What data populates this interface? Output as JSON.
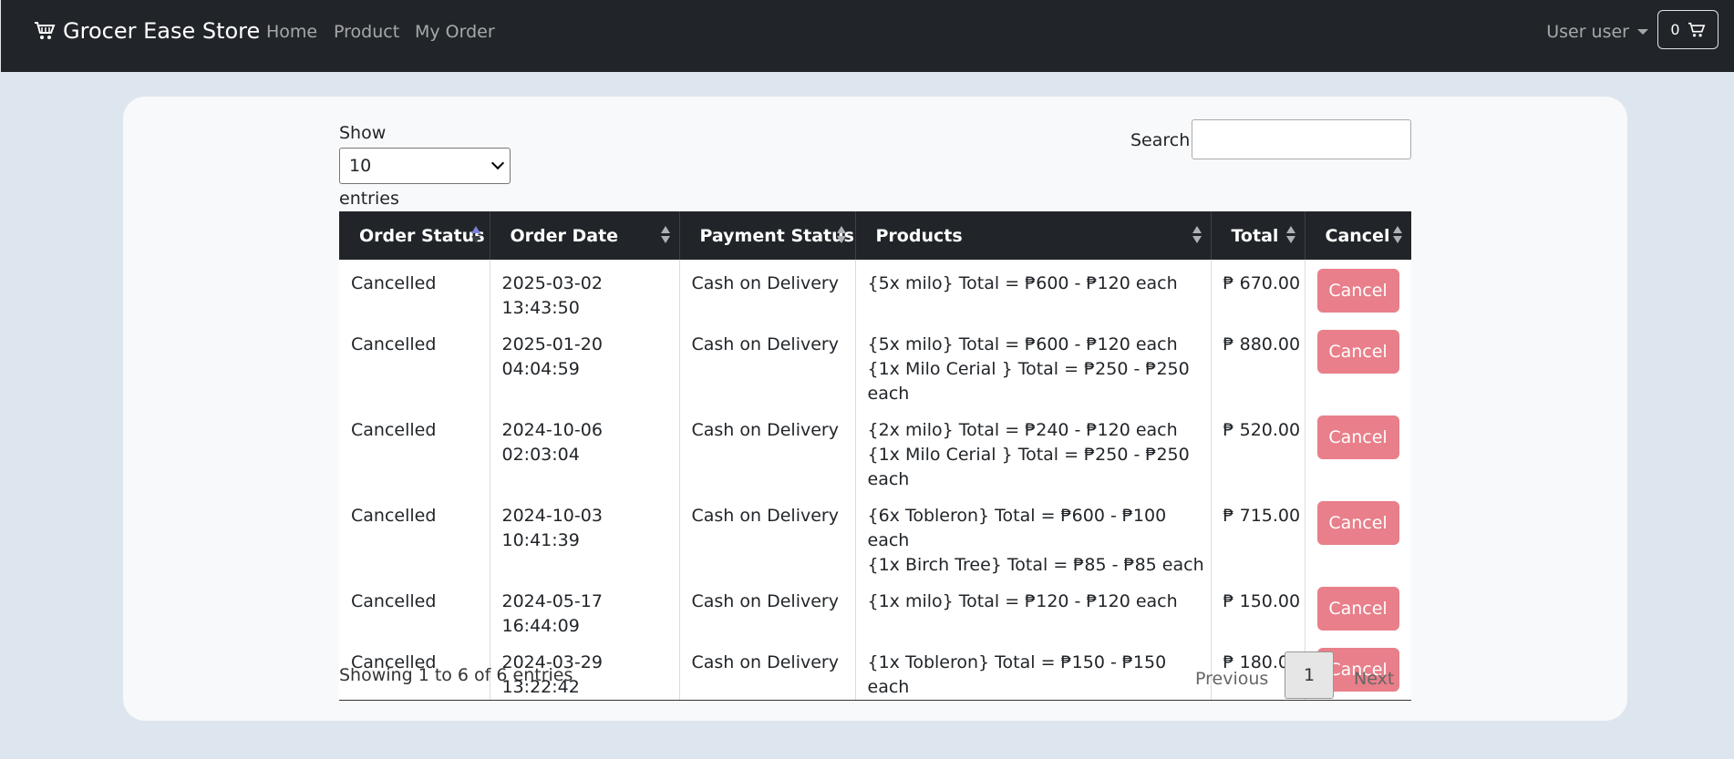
{
  "nav": {
    "brand": "Grocer Ease Store",
    "links": [
      "Home",
      "Product",
      "My Order"
    ],
    "user": "User user",
    "cart_count": "0"
  },
  "table_controls": {
    "show_label": "Show",
    "page_size": "10",
    "entries_label": "entries",
    "search_label": "Search:",
    "search_value": ""
  },
  "table": {
    "headers": [
      "Order Status",
      "Order Date",
      "Payment Status",
      "Products",
      "Total",
      "Cancel"
    ],
    "rows": [
      {
        "status": "Cancelled",
        "date": "2025-03-02 13:43:50",
        "payment": "Cash on Delivery",
        "products": [
          "{5x milo} Total = ₱600 - ₱120 each"
        ],
        "total": "₱ 670.00",
        "action": "Cancel"
      },
      {
        "status": "Cancelled",
        "date": "2025-01-20 04:04:59",
        "payment": "Cash on Delivery",
        "products": [
          "{5x milo} Total = ₱600 - ₱120 each",
          "{1x Milo Cerial } Total = ₱250 - ₱250 each"
        ],
        "total": "₱ 880.00",
        "action": "Cancel"
      },
      {
        "status": "Cancelled",
        "date": "2024-10-06 02:03:04",
        "payment": "Cash on Delivery",
        "products": [
          "{2x milo} Total = ₱240 - ₱120 each",
          "{1x Milo Cerial } Total = ₱250 - ₱250 each"
        ],
        "total": "₱ 520.00",
        "action": "Cancel"
      },
      {
        "status": "Cancelled",
        "date": "2024-10-03 10:41:39",
        "payment": "Cash on Delivery",
        "products": [
          "{6x Tobleron} Total = ₱600 - ₱100 each",
          "{1x Birch Tree} Total = ₱85 - ₱85 each"
        ],
        "total": "₱ 715.00",
        "action": "Cancel"
      },
      {
        "status": "Cancelled",
        "date": "2024-05-17 16:44:09",
        "payment": "Cash on Delivery",
        "products": [
          "{1x milo} Total = ₱120 - ₱120 each"
        ],
        "total": "₱ 150.00",
        "action": "Cancel"
      },
      {
        "status": "Cancelled",
        "date": "2024-03-29 13:22:42",
        "payment": "Cash on Delivery",
        "products": [
          "{1x Tobleron} Total = ₱150 - ₱150 each"
        ],
        "total": "₱ 180.00",
        "action": "Cancel"
      }
    ]
  },
  "footer": {
    "info": "Showing 1 to 6 of 6 entries",
    "previous": "Previous",
    "current_page": "1",
    "next": "Next"
  },
  "colors": {
    "navbar": "#212529",
    "cancel_button": "#e87f8a",
    "page_bg": "#dde5ee"
  },
  "icons": [
    "cart-icon"
  ]
}
